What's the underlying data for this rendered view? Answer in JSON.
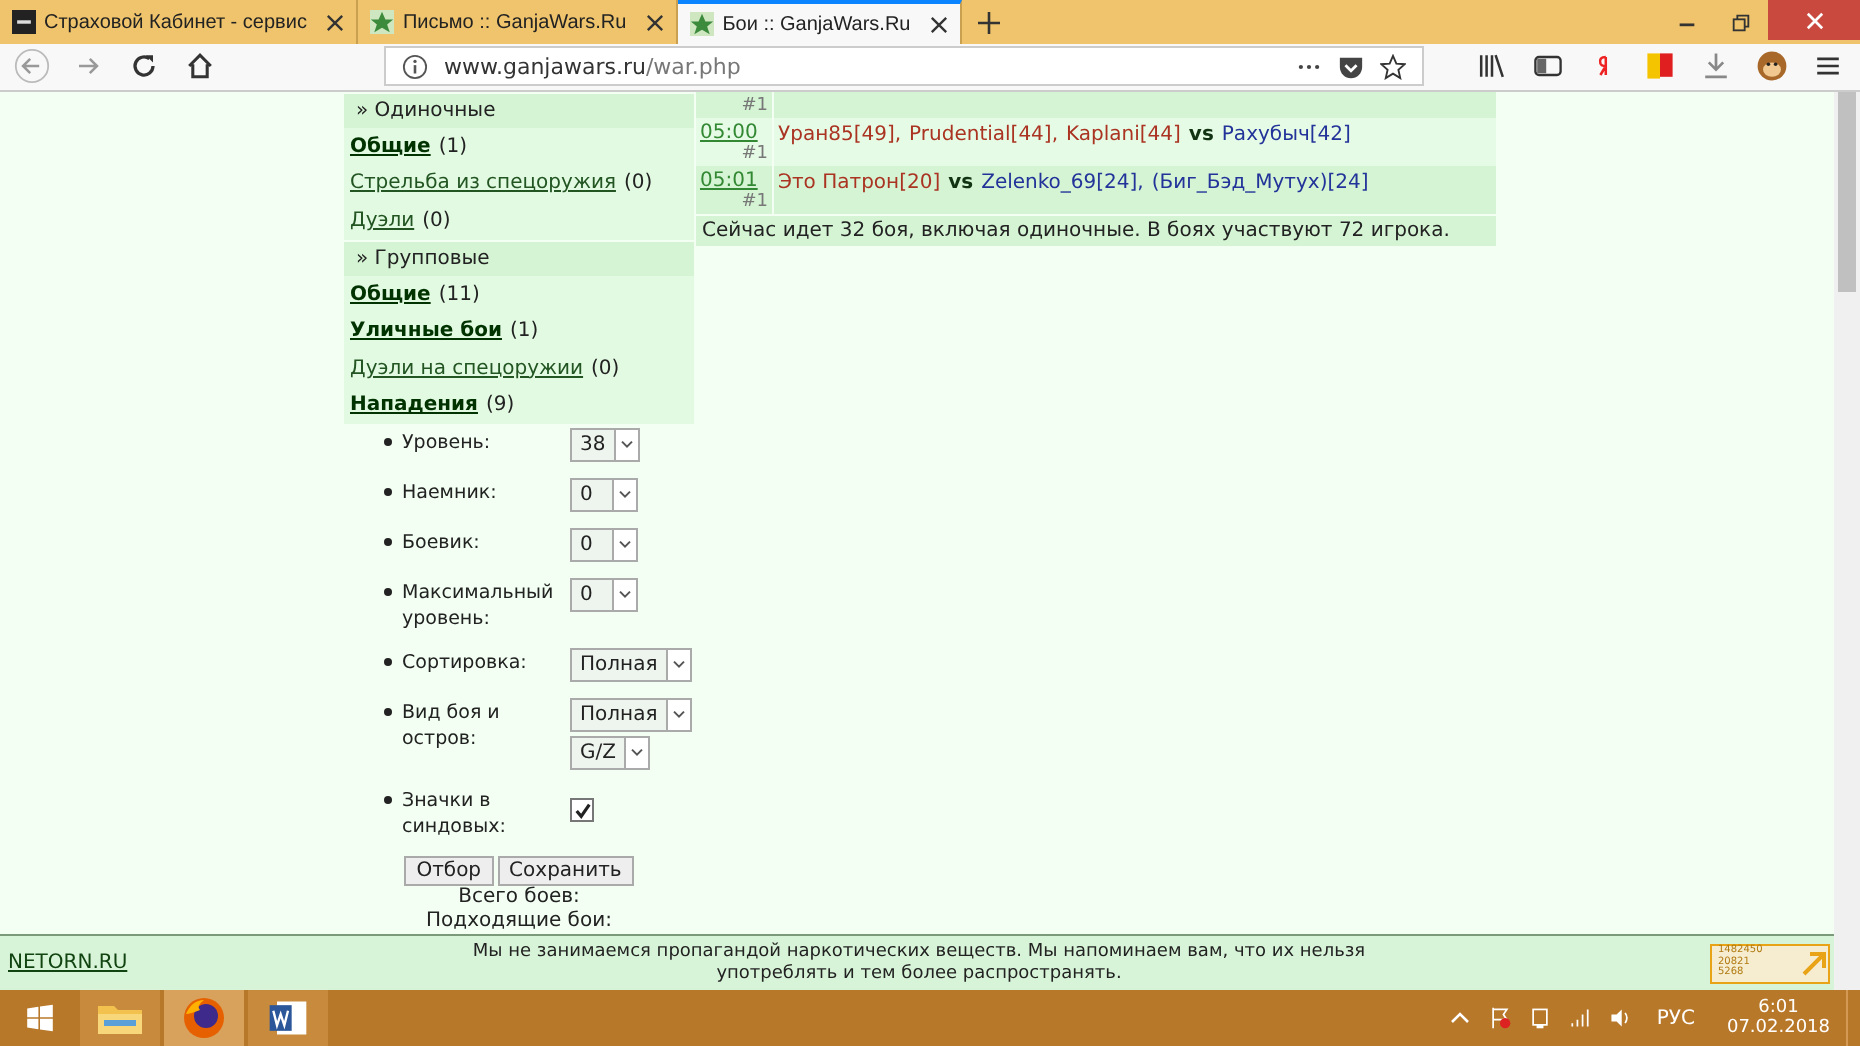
{
  "browser": {
    "tabs": [
      {
        "label": "Страховой Кабинет - сервис",
        "kind": "ck",
        "selected": false
      },
      {
        "label": "Письмо :: GanjaWars.Ru",
        "kind": "star",
        "selected": false
      },
      {
        "label": "Бои :: GanjaWars.Ru",
        "kind": "star",
        "selected": true
      }
    ],
    "url": {
      "host": "www.ganjawars.ru",
      "path": "/war.php"
    }
  },
  "sidebar": [
    {
      "header": "» Одиночные",
      "items": [
        {
          "label": "Общие",
          "count": "(1)",
          "emphasized": true
        },
        {
          "label": "Стрельба из спецоружия",
          "count": "(0)",
          "emphasized": false
        },
        {
          "label": "Дуэли",
          "count": "(0)",
          "emphasized": false
        }
      ]
    },
    {
      "header": "» Групповые",
      "items": [
        {
          "label": "Общие",
          "count": "(11)",
          "emphasized": true
        },
        {
          "label": "Уличные бои",
          "count": "(1)",
          "emphasized": true
        },
        {
          "label": "Дуэли на спецоружии",
          "count": "(0)",
          "emphasized": false
        },
        {
          "label": "Нападения",
          "count": "(9)",
          "emphasized": true
        }
      ]
    }
  ],
  "filters": [
    {
      "label": "Уровень:",
      "kind": "select",
      "values": [
        "38"
      ]
    },
    {
      "label": "Наемник:",
      "kind": "select",
      "values": [
        "0"
      ]
    },
    {
      "label": "Боевик:",
      "kind": "select",
      "values": [
        "0"
      ]
    },
    {
      "label": "Максимальный уровень:",
      "kind": "select",
      "values": [
        "0"
      ]
    },
    {
      "label": "Сортировка:",
      "kind": "select",
      "values": [
        "Полная"
      ]
    },
    {
      "label": "Вид боя и остров:",
      "kind": "select",
      "values": [
        "Полная",
        "G/Z"
      ]
    },
    {
      "label": "Значки в синдовых:",
      "kind": "checkbox",
      "checked": true
    }
  ],
  "buttons": [
    "Отбор",
    "Сохранить"
  ],
  "totals": [
    "Всего боев:",
    "Подходящие бои:"
  ],
  "battles": [
    {
      "number": "#1",
      "shaded": true
    },
    {
      "time": "05:00",
      "number": "#1",
      "shaded": false,
      "team1": [
        {
          "name": "Уран85[49],",
          "color": "#aa3322"
        },
        {
          "name": "Prudential[44],",
          "color": "#aa3322"
        },
        {
          "name": "Kaplani[44]",
          "color": "#aa3322"
        }
      ],
      "vs": "vs",
      "team2": [
        {
          "name": "Рахубыч[42]",
          "color": "#223399"
        }
      ]
    },
    {
      "time": "05:01",
      "number": "#1",
      "shaded": true,
      "team1": [
        {
          "name": "Это Патрон[20]",
          "color": "#aa3322"
        }
      ],
      "vs": "vs",
      "team2": [
        {
          "name": "Zelenko_69[24],",
          "color": "#223399"
        },
        {
          "name": "(Биг_Бэд_Мутух)[24]",
          "color": "#223399"
        }
      ]
    }
  ],
  "summary": "Сейчас идет 32 боя, включая одиночные. В боях участвуют 72 игрока.",
  "footer": {
    "link": "NETORN.RU",
    "notice": "Мы не занимаемся пропагандой наркотических веществ. Мы напоминаем вам, что их нельзя употреблять и тем более распространять.",
    "counter": [
      "1482450",
      "20821",
      "5268"
    ]
  },
  "taskbar": {
    "lang": "РУС",
    "time": "6:01",
    "date": "07.02.2018"
  }
}
